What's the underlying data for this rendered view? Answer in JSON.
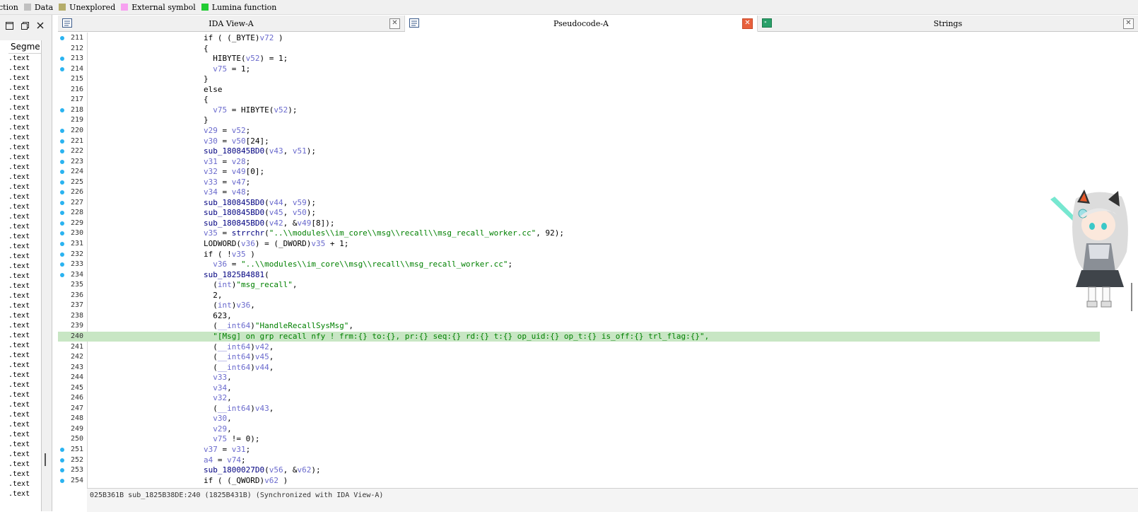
{
  "legend": [
    {
      "label": "ction",
      "color": ""
    },
    {
      "label": "Data",
      "color": "#c0c0c0"
    },
    {
      "label": "Unexplored",
      "color": "#b5ad6a"
    },
    {
      "label": "External symbol",
      "color": "#f7a1f0"
    },
    {
      "label": "Lumina function",
      "color": "#22cc33"
    }
  ],
  "left_pane": {
    "segment_header": "Segme",
    "segments": [
      ".text",
      ".text",
      ".text",
      ".text",
      ".text",
      ".text",
      ".text",
      ".text",
      ".text",
      ".text",
      ".text",
      ".text",
      ".text",
      ".text",
      ".text",
      ".text",
      ".text",
      ".text",
      ".text",
      ".text",
      ".text",
      ".text",
      ".text",
      ".text",
      ".text",
      ".text",
      ".text",
      ".text",
      ".text",
      ".text",
      ".text",
      ".text",
      ".text",
      ".text",
      ".text",
      ".text",
      ".text",
      ".text",
      ".text",
      ".text",
      ".text",
      ".text",
      ".text",
      ".text",
      ".text"
    ]
  },
  "tabs": [
    {
      "label": "IDA View-A",
      "icon": "ida-view-icon",
      "active": false
    },
    {
      "label": "Pseudocode-A",
      "icon": "pseudocode-icon",
      "active": true
    },
    {
      "label": "Strings",
      "icon": "strings-icon",
      "active": false
    }
  ],
  "code_lines": [
    {
      "n": "211",
      "dot": true,
      "hl": false,
      "parts": [
        [
          "k",
          "if ( (_BYTE)"
        ],
        [
          "v",
          "v72"
        ],
        [
          "k",
          " )"
        ]
      ]
    },
    {
      "n": "212",
      "dot": false,
      "hl": false,
      "parts": [
        [
          "k",
          "{"
        ]
      ]
    },
    {
      "n": "213",
      "dot": true,
      "hl": false,
      "parts": [
        [
          "k",
          "  HIBYTE("
        ],
        [
          "v",
          "v52"
        ],
        [
          "k",
          ") = 1;"
        ]
      ]
    },
    {
      "n": "214",
      "dot": true,
      "hl": false,
      "parts": [
        [
          "v",
          "  v75"
        ],
        [
          "k",
          " = 1;"
        ]
      ]
    },
    {
      "n": "215",
      "dot": false,
      "hl": false,
      "parts": [
        [
          "k",
          "}"
        ]
      ]
    },
    {
      "n": "216",
      "dot": false,
      "hl": false,
      "parts": [
        [
          "k",
          "else"
        ]
      ]
    },
    {
      "n": "217",
      "dot": false,
      "hl": false,
      "parts": [
        [
          "k",
          "{"
        ]
      ]
    },
    {
      "n": "218",
      "dot": true,
      "hl": false,
      "parts": [
        [
          "v",
          "  v75"
        ],
        [
          "k",
          " = HIBYTE("
        ],
        [
          "v",
          "v52"
        ],
        [
          "k",
          ");"
        ]
      ]
    },
    {
      "n": "219",
      "dot": false,
      "hl": false,
      "parts": [
        [
          "k",
          "}"
        ]
      ]
    },
    {
      "n": "220",
      "dot": true,
      "hl": false,
      "parts": [
        [
          "v",
          "v29"
        ],
        [
          "k",
          " = "
        ],
        [
          "v",
          "v52"
        ],
        [
          "k",
          ";"
        ]
      ]
    },
    {
      "n": "221",
      "dot": true,
      "hl": false,
      "parts": [
        [
          "v",
          "v30"
        ],
        [
          "k",
          " = "
        ],
        [
          "v",
          "v50"
        ],
        [
          "k",
          "[24];"
        ]
      ]
    },
    {
      "n": "222",
      "dot": true,
      "hl": false,
      "parts": [
        [
          "f",
          "sub_180845BD0"
        ],
        [
          "k",
          "("
        ],
        [
          "v",
          "v43"
        ],
        [
          "k",
          ", "
        ],
        [
          "v",
          "v51"
        ],
        [
          "k",
          ");"
        ]
      ]
    },
    {
      "n": "223",
      "dot": true,
      "hl": false,
      "parts": [
        [
          "v",
          "v31"
        ],
        [
          "k",
          " = "
        ],
        [
          "v",
          "v28"
        ],
        [
          "k",
          ";"
        ]
      ]
    },
    {
      "n": "224",
      "dot": true,
      "hl": false,
      "parts": [
        [
          "v",
          "v32"
        ],
        [
          "k",
          " = "
        ],
        [
          "v",
          "v49"
        ],
        [
          "k",
          "[0];"
        ]
      ]
    },
    {
      "n": "225",
      "dot": true,
      "hl": false,
      "parts": [
        [
          "v",
          "v33"
        ],
        [
          "k",
          " = "
        ],
        [
          "v",
          "v47"
        ],
        [
          "k",
          ";"
        ]
      ]
    },
    {
      "n": "226",
      "dot": true,
      "hl": false,
      "parts": [
        [
          "v",
          "v34"
        ],
        [
          "k",
          " = "
        ],
        [
          "v",
          "v48"
        ],
        [
          "k",
          ";"
        ]
      ]
    },
    {
      "n": "227",
      "dot": true,
      "hl": false,
      "parts": [
        [
          "f",
          "sub_180845BD0"
        ],
        [
          "k",
          "("
        ],
        [
          "v",
          "v44"
        ],
        [
          "k",
          ", "
        ],
        [
          "v",
          "v59"
        ],
        [
          "k",
          ");"
        ]
      ]
    },
    {
      "n": "228",
      "dot": true,
      "hl": false,
      "parts": [
        [
          "f",
          "sub_180845BD0"
        ],
        [
          "k",
          "("
        ],
        [
          "v",
          "v45"
        ],
        [
          "k",
          ", "
        ],
        [
          "v",
          "v50"
        ],
        [
          "k",
          ");"
        ]
      ]
    },
    {
      "n": "229",
      "dot": true,
      "hl": false,
      "parts": [
        [
          "f",
          "sub_180845BD0"
        ],
        [
          "k",
          "("
        ],
        [
          "v",
          "v42"
        ],
        [
          "k",
          ", &"
        ],
        [
          "v",
          "v49"
        ],
        [
          "k",
          "[8]);"
        ]
      ]
    },
    {
      "n": "230",
      "dot": true,
      "hl": false,
      "parts": [
        [
          "v",
          "v35"
        ],
        [
          "k",
          " = "
        ],
        [
          "f",
          "strrchr"
        ],
        [
          "k",
          "("
        ],
        [
          "s",
          "\"..\\\\modules\\\\im_core\\\\msg\\\\recall\\\\msg_recall_worker.cc\""
        ],
        [
          "k",
          ", 92);"
        ]
      ]
    },
    {
      "n": "231",
      "dot": true,
      "hl": false,
      "parts": [
        [
          "k",
          "LODWORD("
        ],
        [
          "v",
          "v36"
        ],
        [
          "k",
          ") = (_DWORD)"
        ],
        [
          "v",
          "v35"
        ],
        [
          "k",
          " + 1;"
        ]
      ]
    },
    {
      "n": "232",
      "dot": true,
      "hl": false,
      "parts": [
        [
          "k",
          "if ( !"
        ],
        [
          "v",
          "v35"
        ],
        [
          "k",
          " )"
        ]
      ]
    },
    {
      "n": "233",
      "dot": true,
      "hl": false,
      "parts": [
        [
          "v",
          "  v36"
        ],
        [
          "k",
          " = "
        ],
        [
          "s",
          "\"..\\\\modules\\\\im_core\\\\msg\\\\recall\\\\msg_recall_worker.cc\""
        ],
        [
          "k",
          ";"
        ]
      ]
    },
    {
      "n": "234",
      "dot": true,
      "hl": false,
      "parts": [
        [
          "f",
          "sub_1825B4881"
        ],
        [
          "k",
          "("
        ]
      ]
    },
    {
      "n": "235",
      "dot": false,
      "hl": false,
      "parts": [
        [
          "k",
          "  ("
        ],
        [
          "v",
          "int"
        ],
        [
          "k",
          ")"
        ],
        [
          "s",
          "\"msg_recall\""
        ],
        [
          "k",
          ","
        ]
      ]
    },
    {
      "n": "236",
      "dot": false,
      "hl": false,
      "parts": [
        [
          "k",
          "  2,"
        ]
      ]
    },
    {
      "n": "237",
      "dot": false,
      "hl": false,
      "parts": [
        [
          "k",
          "  ("
        ],
        [
          "v",
          "int"
        ],
        [
          "k",
          ")"
        ],
        [
          "v",
          "v36"
        ],
        [
          "k",
          ","
        ]
      ]
    },
    {
      "n": "238",
      "dot": false,
      "hl": false,
      "parts": [
        [
          "k",
          "  623,"
        ]
      ]
    },
    {
      "n": "239",
      "dot": false,
      "hl": false,
      "parts": [
        [
          "k",
          "  ("
        ],
        [
          "v",
          "__int64"
        ],
        [
          "k",
          ")"
        ],
        [
          "s",
          "\"HandleRecallSysMsg\""
        ],
        [
          "k",
          ","
        ]
      ]
    },
    {
      "n": "240",
      "dot": false,
      "hl": true,
      "parts": [
        [
          "s",
          "  \"[Msg] on grp recall nfy ! frm:{} to:{}, pr:{} seq:{} rd:{} t:{} op_uid:{} op_t:{} is_off:{} trl_flag:{}\""
        ],
        [
          "s",
          ","
        ]
      ]
    },
    {
      "n": "241",
      "dot": false,
      "hl": false,
      "parts": [
        [
          "k",
          "  ("
        ],
        [
          "v",
          "__int64"
        ],
        [
          "k",
          ")"
        ],
        [
          "v",
          "v42"
        ],
        [
          "k",
          ","
        ]
      ]
    },
    {
      "n": "242",
      "dot": false,
      "hl": false,
      "parts": [
        [
          "k",
          "  ("
        ],
        [
          "v",
          "__int64"
        ],
        [
          "k",
          ")"
        ],
        [
          "v",
          "v45"
        ],
        [
          "k",
          ","
        ]
      ]
    },
    {
      "n": "243",
      "dot": false,
      "hl": false,
      "parts": [
        [
          "k",
          "  ("
        ],
        [
          "v",
          "__int64"
        ],
        [
          "k",
          ")"
        ],
        [
          "v",
          "v44"
        ],
        [
          "k",
          ","
        ]
      ]
    },
    {
      "n": "244",
      "dot": false,
      "hl": false,
      "parts": [
        [
          "v",
          "  v33"
        ],
        [
          "k",
          ","
        ]
      ]
    },
    {
      "n": "245",
      "dot": false,
      "hl": false,
      "parts": [
        [
          "v",
          "  v34"
        ],
        [
          "k",
          ","
        ]
      ]
    },
    {
      "n": "246",
      "dot": false,
      "hl": false,
      "parts": [
        [
          "v",
          "  v32"
        ],
        [
          "k",
          ","
        ]
      ]
    },
    {
      "n": "247",
      "dot": false,
      "hl": false,
      "parts": [
        [
          "k",
          "  ("
        ],
        [
          "v",
          "__int64"
        ],
        [
          "k",
          ")"
        ],
        [
          "v",
          "v43"
        ],
        [
          "k",
          ","
        ]
      ]
    },
    {
      "n": "248",
      "dot": false,
      "hl": false,
      "parts": [
        [
          "v",
          "  v30"
        ],
        [
          "k",
          ","
        ]
      ]
    },
    {
      "n": "249",
      "dot": false,
      "hl": false,
      "parts": [
        [
          "v",
          "  v29"
        ],
        [
          "k",
          ","
        ]
      ]
    },
    {
      "n": "250",
      "dot": false,
      "hl": false,
      "parts": [
        [
          "v",
          "  v75"
        ],
        [
          "k",
          " != 0);"
        ]
      ]
    },
    {
      "n": "251",
      "dot": true,
      "hl": false,
      "parts": [
        [
          "v",
          "v37"
        ],
        [
          "k",
          " = "
        ],
        [
          "v",
          "v31"
        ],
        [
          "k",
          ";"
        ]
      ]
    },
    {
      "n": "252",
      "dot": true,
      "hl": false,
      "parts": [
        [
          "v",
          "a4"
        ],
        [
          "k",
          " = "
        ],
        [
          "v",
          "v74"
        ],
        [
          "k",
          ";"
        ]
      ]
    },
    {
      "n": "253",
      "dot": true,
      "hl": false,
      "parts": [
        [
          "f",
          "sub_1800027D0"
        ],
        [
          "k",
          "("
        ],
        [
          "v",
          "v56"
        ],
        [
          "k",
          ", &"
        ],
        [
          "v",
          "v62"
        ],
        [
          "k",
          ");"
        ]
      ]
    },
    {
      "n": "254",
      "dot": true,
      "hl": false,
      "parts": [
        [
          "k",
          "if ( (_QWORD)"
        ],
        [
          "v",
          "v62"
        ],
        [
          "k",
          " )"
        ]
      ]
    }
  ],
  "status": {
    "text": "025B361B  sub_1825B38DE:240 (1825B431B)  (Synchronized with IDA View-A)"
  }
}
